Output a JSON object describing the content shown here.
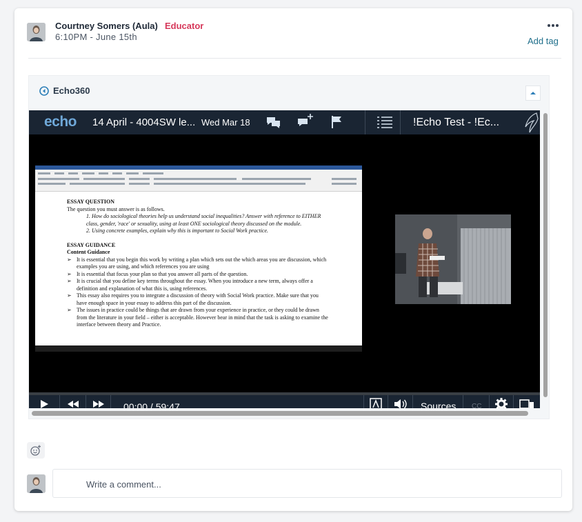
{
  "post": {
    "author": "Courtney Somers (Aula)",
    "role": "Educator",
    "timestamp": "6:10PM - June 15th",
    "add_tag_label": "Add tag",
    "more_icon": "more-dots-icon"
  },
  "embed": {
    "provider": "Echo360",
    "player": {
      "logo_text": "echo",
      "title": "14 April - 4004SW le...",
      "date": "Wed Mar 18",
      "course": "!Echo Test - !Ec...",
      "timecode": "00:00 / 59:47",
      "sources_label": "Sources",
      "cc_label": "CC",
      "progress": 0,
      "document": {
        "heading1": "ESSAY QUESTION",
        "intro": "The question you must answer is as follows.",
        "q1": "1.   How do sociological theories help us understand social inequalities? Answer with reference to EITHER class, gender, 'race' or sexuality, using at least ONE sociological theory discussed on the module.",
        "q2": "2.   Using concrete examples, explain why this is important to Social Work practice.",
        "heading2": "ESSAY GUIDANCE",
        "subheading": "Content Guidance",
        "b1": "It is essential that you begin this work by writing a plan which sets out the which areas you are discussion, which examples you are using, and which references you are using",
        "b2": "It is essential that focus your plan so that you answer all parts of the question.",
        "b3": "It is crucial that you define key terms throughout the essay. When you introduce a new term, always offer a definition and explanation of what this is, using references.",
        "b4": "This essay also requires you to integrate a discussion of theory with Social Work practice. Make sure that you have enough space in your essay to address this part of the discussion.",
        "b5": "The issues in practice could be things that are drawn from your experience in practice, or they could be drawn from the literature in your field – either is acceptable. However bear in mind that the task is asking to examine the interface between theory and Practice."
      }
    }
  },
  "comment": {
    "placeholder": "Write a comment..."
  },
  "colors": {
    "role": "#d6385a",
    "link": "#1f6f8b",
    "player_bar": "#1a2533"
  }
}
